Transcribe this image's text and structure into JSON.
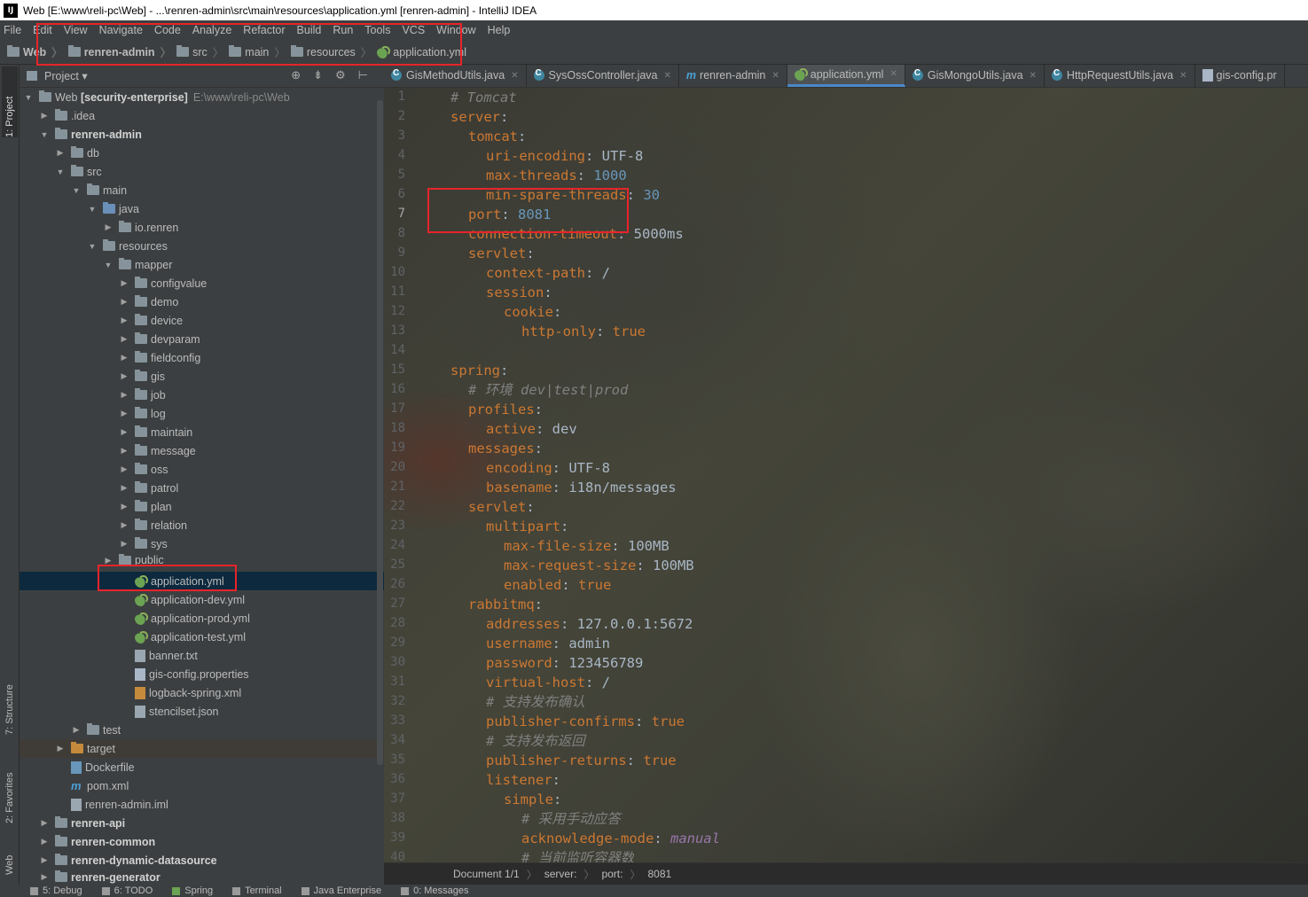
{
  "titlebar": {
    "icon": "IJ",
    "title": "Web [E:\\www\\reli-pc\\Web] - ...\\renren-admin\\src\\main\\resources\\application.yml [renren-admin] - IntelliJ IDEA"
  },
  "menu": [
    "File",
    "Edit",
    "View",
    "Navigate",
    "Code",
    "Analyze",
    "Refactor",
    "Build",
    "Run",
    "Tools",
    "VCS",
    "Window",
    "Help"
  ],
  "breadcrumb": [
    "Web",
    "renren-admin",
    "src",
    "main",
    "resources",
    "application.yml"
  ],
  "project_panel": {
    "title": "Project",
    "dropdown": "▾"
  },
  "left_strip": {
    "project": "1: Project",
    "structure": "7: Structure",
    "favorites": "2: Favorites",
    "web": "Web"
  },
  "tree": [
    {
      "label": "Web",
      "bold": "[security-enterprise]",
      "path": "E:\\www\\reli-pc\\Web"
    },
    {
      "label": ".idea"
    },
    {
      "label": "renren-admin"
    },
    {
      "label": "db"
    },
    {
      "label": "src"
    },
    {
      "label": "main"
    },
    {
      "label": "java"
    },
    {
      "label": "io.renren"
    },
    {
      "label": "resources"
    },
    {
      "label": "mapper"
    },
    {
      "label": "configvalue"
    },
    {
      "label": "demo"
    },
    {
      "label": "device"
    },
    {
      "label": "devparam"
    },
    {
      "label": "fieldconfig"
    },
    {
      "label": "gis"
    },
    {
      "label": "job"
    },
    {
      "label": "log"
    },
    {
      "label": "maintain"
    },
    {
      "label": "message"
    },
    {
      "label": "oss"
    },
    {
      "label": "patrol"
    },
    {
      "label": "plan"
    },
    {
      "label": "relation"
    },
    {
      "label": "sys"
    },
    {
      "label": "public"
    },
    {
      "label": "application.yml"
    },
    {
      "label": "application-dev.yml"
    },
    {
      "label": "application-prod.yml"
    },
    {
      "label": "application-test.yml"
    },
    {
      "label": "banner.txt"
    },
    {
      "label": "gis-config.properties"
    },
    {
      "label": "logback-spring.xml"
    },
    {
      "label": "stencilset.json"
    },
    {
      "label": "test"
    },
    {
      "label": "target"
    },
    {
      "label": "Dockerfile"
    },
    {
      "label": "pom.xml"
    },
    {
      "label": "renren-admin.iml"
    },
    {
      "label": "renren-api"
    },
    {
      "label": "renren-common"
    },
    {
      "label": "renren-dynamic-datasource"
    },
    {
      "label": "renren-generator"
    }
  ],
  "tabs": [
    "GisMethodUtils.java",
    "SysOssController.java",
    "renren-admin",
    "application.yml",
    "GisMongoUtils.java",
    "HttpRequestUtils.java",
    "gis-config.pr"
  ],
  "line_numbers": [
    "1",
    "2",
    "3",
    "4",
    "5",
    "6",
    "7",
    "8",
    "9",
    "10",
    "11",
    "12",
    "13",
    "14",
    "15",
    "16",
    "17",
    "18",
    "19",
    "20",
    "21",
    "22",
    "23",
    "24",
    "25",
    "26",
    "27",
    "28",
    "29",
    "30",
    "31",
    "32",
    "33",
    "34",
    "35",
    "36",
    "37",
    "38",
    "39",
    "40"
  ],
  "code": {
    "l1": "# Tomcat",
    "l2k": "server",
    "l3k": "tomcat",
    "l4k": "uri-encoding",
    "l4v": "UTF-8",
    "l5k": "max-threads",
    "l5v": "1000",
    "l6k": "min-spare-threads",
    "l6v": "30",
    "l7k": "port",
    "l7v": "8081",
    "l8k": "connection-timeout",
    "l8v": "5000ms",
    "l9k": "servlet",
    "l10k": "context-path",
    "l10v": "/",
    "l11k": "session",
    "l12k": "cookie",
    "l13k": "http-only",
    "l13v": "true",
    "l15k": "spring",
    "l16": "# 环境 dev|test|prod",
    "l17k": "profiles",
    "l18k": "active",
    "l18v": "dev",
    "l19k": "messages",
    "l20k": "encoding",
    "l20v": "UTF-8",
    "l21k": "basename",
    "l21v": "i18n/messages",
    "l22k": "servlet",
    "l23k": "multipart",
    "l24k": "max-file-size",
    "l24v": "100MB",
    "l25k": "max-request-size",
    "l25v": "100MB",
    "l26k": "enabled",
    "l26v": "true",
    "l27k": "rabbitmq",
    "l28k": "addresses",
    "l28v": "127.0.0.1:5672",
    "l29k": "username",
    "l29v": "admin",
    "l30k": "password",
    "l30v": "123456789",
    "l31k": "virtual-host",
    "l31v": "/",
    "l32": "# 支持发布确认",
    "l33k": "publisher-confirms",
    "l33v": "true",
    "l34": "# 支持发布返回",
    "l35k": "publisher-returns",
    "l35v": "true",
    "l36k": "listener",
    "l37k": "simple",
    "l38": "# 采用手动应答",
    "l39k": "acknowledge-mode",
    "l39v": "manual",
    "l40": "# 当前监听容器数"
  },
  "status": {
    "doc": "Document 1/1",
    "path1": "server:",
    "path2": "port:",
    "value": "8081"
  },
  "bottom": [
    "5: Debug",
    "6: TODO",
    "Spring",
    "Terminal",
    "Java Enterprise",
    "0: Messages"
  ],
  "colors": {
    "accent": "#4a88c7",
    "key": "#cc7832",
    "number": "#6897bb",
    "comment": "#808080",
    "annotation": "#e8242a"
  }
}
